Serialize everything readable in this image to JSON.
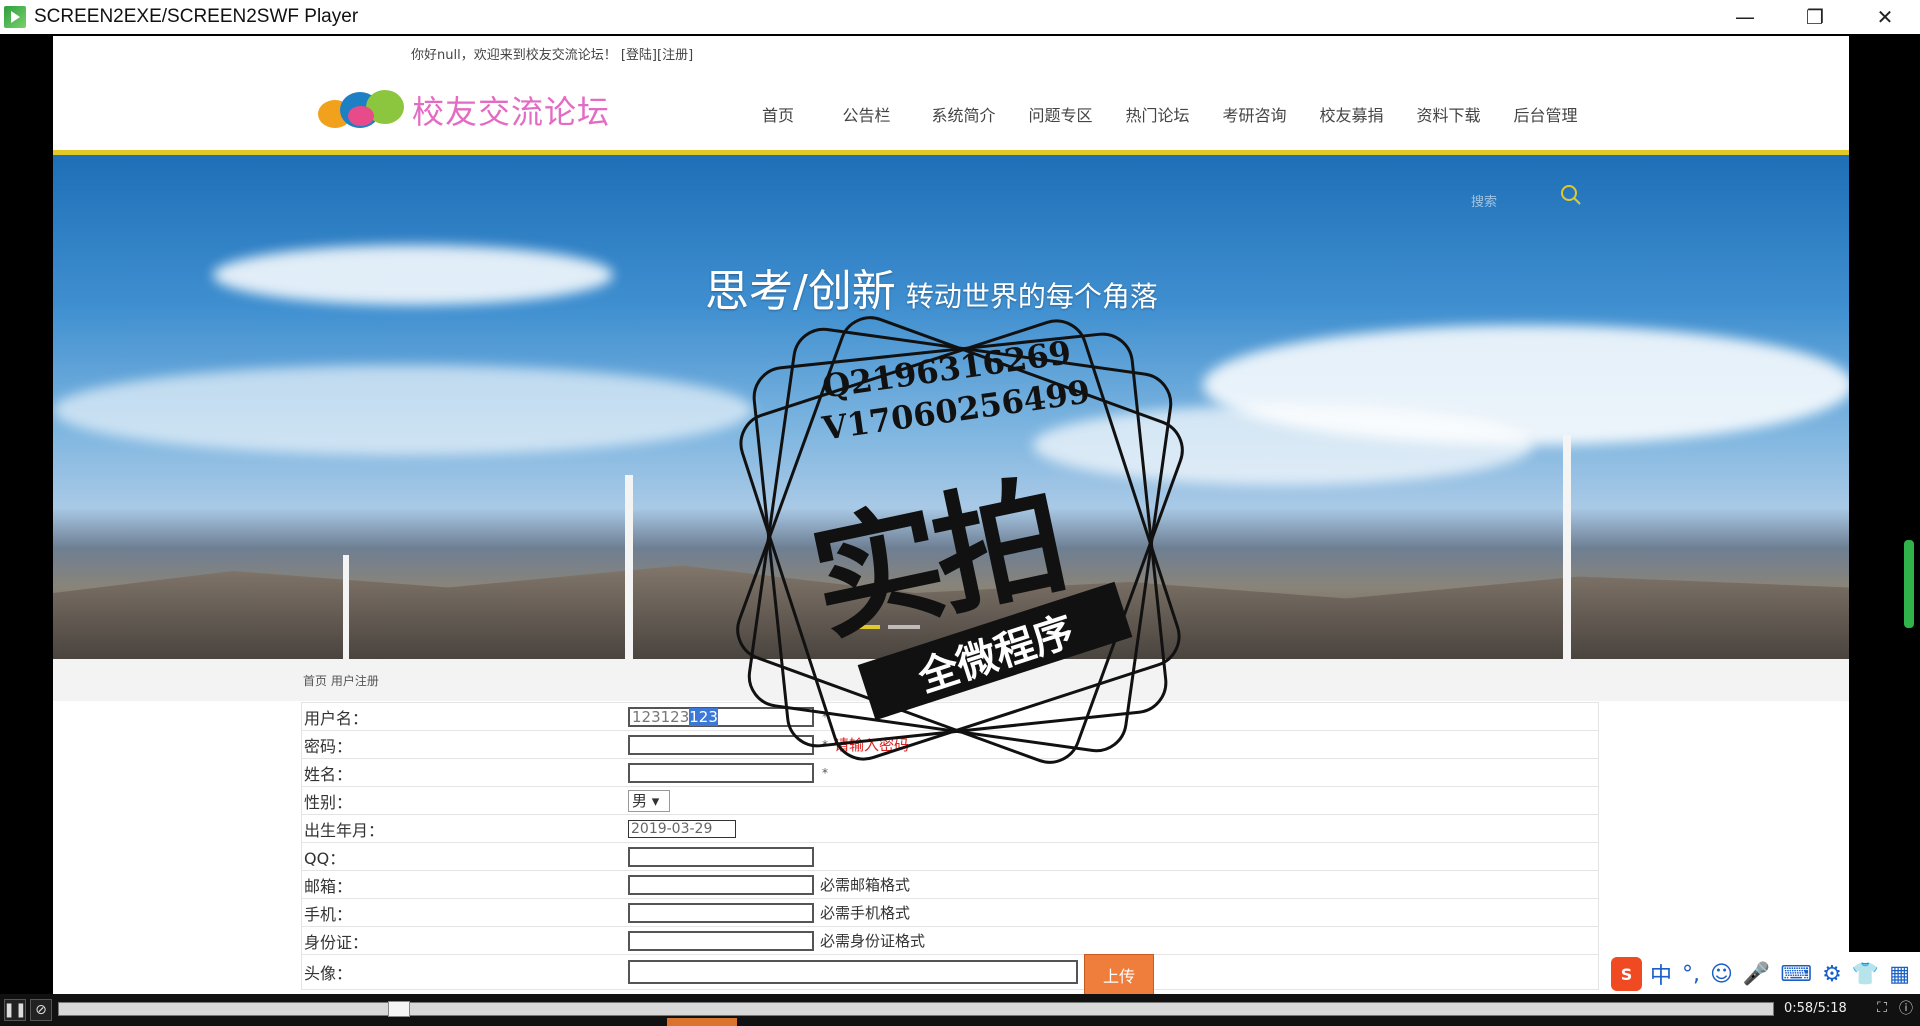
{
  "window": {
    "title": "SCREEN2EXE/SCREEN2SWF Player",
    "minimize": "—",
    "restore": "❐",
    "close": "✕"
  },
  "site": {
    "greeting": "你好null，欢迎来到校友交流论坛！",
    "login_link": "[登陆]",
    "register_link": "[注册]",
    "logo_text": "校友交流论坛",
    "nav": [
      "首页",
      "公告栏",
      "系统简介",
      "问题专区",
      "热门论坛",
      "考研咨询",
      "校友募捐",
      "资料下载",
      "后台管理"
    ]
  },
  "banner": {
    "search_placeholder": "搜索",
    "slogan_big": "思考/创新",
    "slogan_small": "转动世界的每个角落"
  },
  "breadcrumb": "首页 用户注册",
  "form": {
    "username_label": "用户名：",
    "username_value_plain": "123123",
    "username_value_selected": "123",
    "username_req": "*",
    "password_label": "密码：",
    "password_req": "*",
    "password_error": "请输入密码",
    "name_label": "姓名：",
    "name_req": "*",
    "gender_label": "性别：",
    "gender_value": "男",
    "birth_label": "出生年月：",
    "birth_value": "2019-03-29",
    "qq_label": "QQ：",
    "email_label": "邮箱：",
    "email_hint": "必需邮箱格式",
    "phone_label": "手机：",
    "phone_hint": "必需手机格式",
    "idcard_label": "身份证：",
    "idcard_hint": "必需身份证格式",
    "avatar_label": "头像：",
    "upload_button": "上传"
  },
  "watermark": {
    "line1": "Q2196316269",
    "line2": "V17060256499",
    "big": "实拍",
    "ribbon": "全微程序"
  },
  "ime": {
    "logo": "S",
    "mode": "中",
    "punct": "°,",
    "emoji": "☺",
    "mic": "🎤",
    "keyboard": "⌨",
    "tools": "⚙",
    "skin": "👕",
    "grid": "▦"
  },
  "player": {
    "pause": "❚❚",
    "other": "⊘",
    "time": "0:58/5:18",
    "fit": "⛶",
    "info": "ⓘ",
    "progress": 0.19
  }
}
